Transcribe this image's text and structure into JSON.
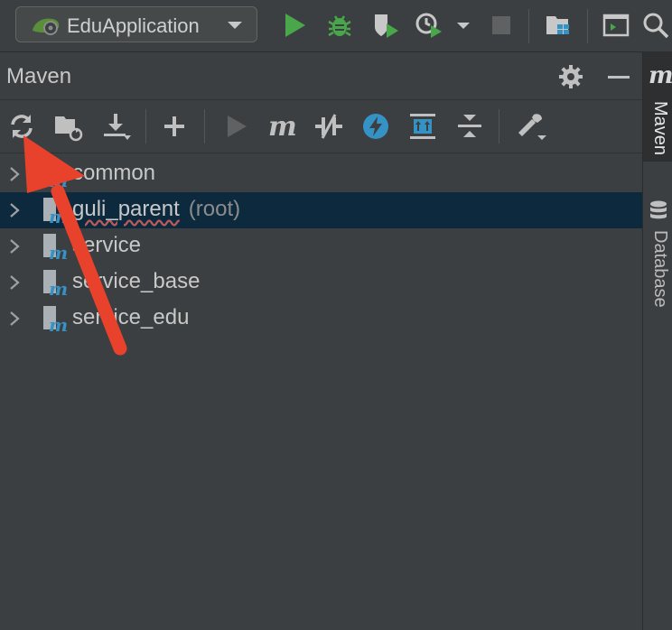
{
  "toolbar": {
    "run_config_label": "EduApplication",
    "icons": [
      "spring-boot-icon",
      "dropdown-arrow-icon",
      "run-icon",
      "debug-icon",
      "coverage-icon",
      "profile-icon",
      "more-run-options-icon",
      "stop-icon",
      "project-structure-icon",
      "terminal-icon",
      "search-icon"
    ]
  },
  "panel": {
    "title": "Maven",
    "header_icons": [
      "gear-icon",
      "minimize-icon"
    ],
    "toolbar_icons": [
      "reload-icon",
      "generate-sources-icon",
      "download-icon",
      "add-icon",
      "run-maven-build-icon",
      "execute-goal-icon",
      "toggle-offline-icon",
      "skip-tests-icon",
      "show-dependencies-icon",
      "collapse-all-icon",
      "maven-settings-icon"
    ]
  },
  "tree": {
    "items": [
      {
        "name": "common",
        "suffix": "",
        "selected": false
      },
      {
        "name": "guli_parent",
        "suffix": "(root)",
        "selected": true
      },
      {
        "name": "service",
        "suffix": "",
        "selected": false
      },
      {
        "name": "service_base",
        "suffix": "",
        "selected": false
      },
      {
        "name": "service_edu",
        "suffix": "",
        "selected": false
      }
    ]
  },
  "right_stripe": {
    "tabs": [
      {
        "label": "Maven",
        "icon": "maven-m-icon",
        "active": true
      },
      {
        "label": "Database",
        "icon": "database-icon",
        "active": false
      }
    ],
    "maven_logo": "m"
  },
  "colors": {
    "background": "#3c3f41",
    "selection": "#0d293e",
    "run_green": "#4aa64a",
    "annotation_red": "#e8412c",
    "accent_blue": "#3592c4"
  }
}
